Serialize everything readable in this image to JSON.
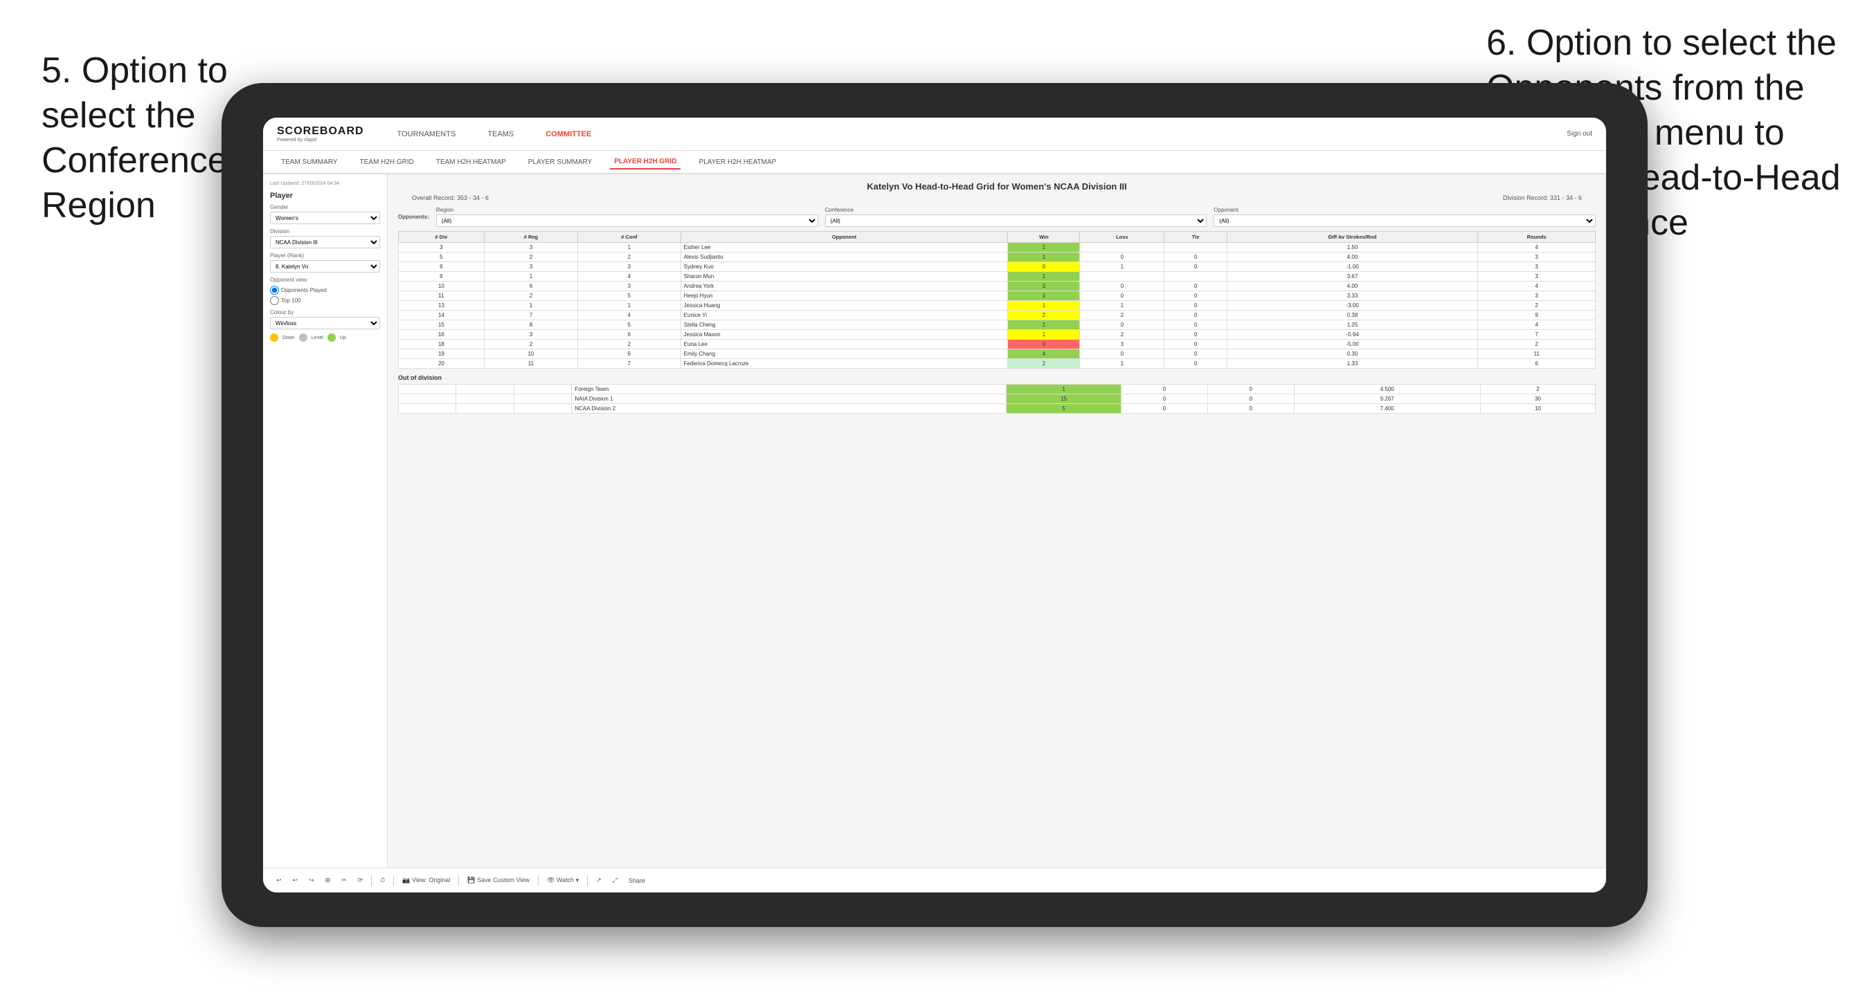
{
  "annotations": {
    "left": "5. Option to select the Conference and Region",
    "right": "6. Option to select the Opponents from the dropdown menu to see the Head-to-Head performance"
  },
  "header": {
    "logo": "SCOREBOARD",
    "logo_sub": "Powered by clippd",
    "nav": [
      "TOURNAMENTS",
      "TEAMS",
      "COMMITTEE"
    ],
    "active_nav": "COMMITTEE",
    "sign_out": "Sign out"
  },
  "sub_nav": [
    "TEAM SUMMARY",
    "TEAM H2H GRID",
    "TEAM H2H HEATMAP",
    "PLAYER SUMMARY",
    "PLAYER H2H GRID",
    "PLAYER H2H HEATMAP"
  ],
  "active_sub_nav": "PLAYER H2H GRID",
  "sidebar": {
    "updated": "Last Updated: 27/03/2024 04:34",
    "section_title": "Player",
    "gender_label": "Gender",
    "gender_value": "Women's",
    "division_label": "Division",
    "division_value": "NCAA Division III",
    "player_rank_label": "Player (Rank)",
    "player_rank_value": "8. Katelyn Vo",
    "opponent_view_label": "Opponent view",
    "opponent_view_options": [
      "Opponents Played",
      "Top 100"
    ],
    "colour_by_label": "Colour by",
    "colour_by_value": "Win/loss",
    "colour_labels": [
      "Down",
      "Level",
      "Up"
    ]
  },
  "report": {
    "title": "Katelyn Vo Head-to-Head Grid for Women's NCAA Division III",
    "overall_record": "Overall Record: 353 - 34 - 6",
    "division_record": "Division Record: 331 - 34 - 6"
  },
  "filters": {
    "region_label": "Region",
    "conference_label": "Conference",
    "opponent_label": "Opponent",
    "opponents_label": "Opponents:",
    "region_value": "(All)",
    "conference_value": "(All)",
    "opponent_value": "(All)"
  },
  "table": {
    "headers": [
      "# Div",
      "# Reg",
      "# Conf",
      "Opponent",
      "Win",
      "Loss",
      "Tie",
      "Diff Av Strokes/Rnd",
      "Rounds"
    ],
    "rows": [
      {
        "div": "3",
        "reg": "3",
        "conf": "1",
        "opponent": "Esther Lee",
        "win": "1",
        "loss": "",
        "tie": "",
        "diff": "1.50",
        "rounds": "4",
        "win_color": "green"
      },
      {
        "div": "5",
        "reg": "2",
        "conf": "2",
        "opponent": "Alexis Sudjianto",
        "win": "1",
        "loss": "0",
        "tie": "0",
        "diff": "4.00",
        "rounds": "3",
        "win_color": "green"
      },
      {
        "div": "6",
        "reg": "3",
        "conf": "3",
        "opponent": "Sydney Kuo",
        "win": "0",
        "loss": "1",
        "tie": "0",
        "diff": "-1.00",
        "rounds": "3",
        "win_color": "yellow"
      },
      {
        "div": "9",
        "reg": "1",
        "conf": "4",
        "opponent": "Sharon Mun",
        "win": "1",
        "loss": "",
        "tie": "",
        "diff": "3.67",
        "rounds": "3",
        "win_color": "green"
      },
      {
        "div": "10",
        "reg": "6",
        "conf": "3",
        "opponent": "Andrea York",
        "win": "2",
        "loss": "0",
        "tie": "0",
        "diff": "4.00",
        "rounds": "4",
        "win_color": "green"
      },
      {
        "div": "11",
        "reg": "2",
        "conf": "5",
        "opponent": "Heejo Hyun",
        "win": "1",
        "loss": "0",
        "tie": "0",
        "diff": "3.33",
        "rounds": "3",
        "win_color": "green"
      },
      {
        "div": "13",
        "reg": "1",
        "conf": "1",
        "opponent": "Jessica Huang",
        "win": "1",
        "loss": "1",
        "tie": "0",
        "diff": "-3.00",
        "rounds": "2",
        "win_color": "yellow"
      },
      {
        "div": "14",
        "reg": "7",
        "conf": "4",
        "opponent": "Eunice Yi",
        "win": "2",
        "loss": "2",
        "tie": "0",
        "diff": "0.38",
        "rounds": "9",
        "win_color": "yellow"
      },
      {
        "div": "15",
        "reg": "8",
        "conf": "5",
        "opponent": "Stella Cheng",
        "win": "1",
        "loss": "0",
        "tie": "0",
        "diff": "1.25",
        "rounds": "4",
        "win_color": "green"
      },
      {
        "div": "16",
        "reg": "3",
        "conf": "6",
        "opponent": "Jessica Mason",
        "win": "1",
        "loss": "2",
        "tie": "0",
        "diff": "-0.94",
        "rounds": "7",
        "win_color": "yellow"
      },
      {
        "div": "18",
        "reg": "2",
        "conf": "2",
        "opponent": "Euna Lee",
        "win": "0",
        "loss": "3",
        "tie": "0",
        "diff": "-5.00",
        "rounds": "2",
        "win_color": "red"
      },
      {
        "div": "19",
        "reg": "10",
        "conf": "6",
        "opponent": "Emily Chang",
        "win": "4",
        "loss": "0",
        "tie": "0",
        "diff": "0.30",
        "rounds": "11",
        "win_color": "green"
      },
      {
        "div": "20",
        "reg": "11",
        "conf": "7",
        "opponent": "Federica Domecq Lacroze",
        "win": "2",
        "loss": "1",
        "tie": "0",
        "diff": "1.33",
        "rounds": "6",
        "win_color": "light-green"
      }
    ]
  },
  "out_of_division": {
    "label": "Out of division",
    "rows": [
      {
        "opponent": "Foreign Team",
        "win": "1",
        "loss": "0",
        "tie": "0",
        "diff": "4.500",
        "rounds": "2"
      },
      {
        "opponent": "NAIA Division 1",
        "win": "15",
        "loss": "0",
        "tie": "0",
        "diff": "9.267",
        "rounds": "30"
      },
      {
        "opponent": "NCAA Division 2",
        "win": "5",
        "loss": "0",
        "tie": "0",
        "diff": "7.400",
        "rounds": "10"
      }
    ]
  },
  "toolbar": {
    "buttons": [
      "↩",
      "↩",
      "↪",
      "⊞",
      "✂",
      "⟳",
      "·",
      "⏱",
      "View: Original",
      "Save Custom View",
      "Watch ▾",
      "↗",
      "⤢",
      "Share"
    ]
  }
}
